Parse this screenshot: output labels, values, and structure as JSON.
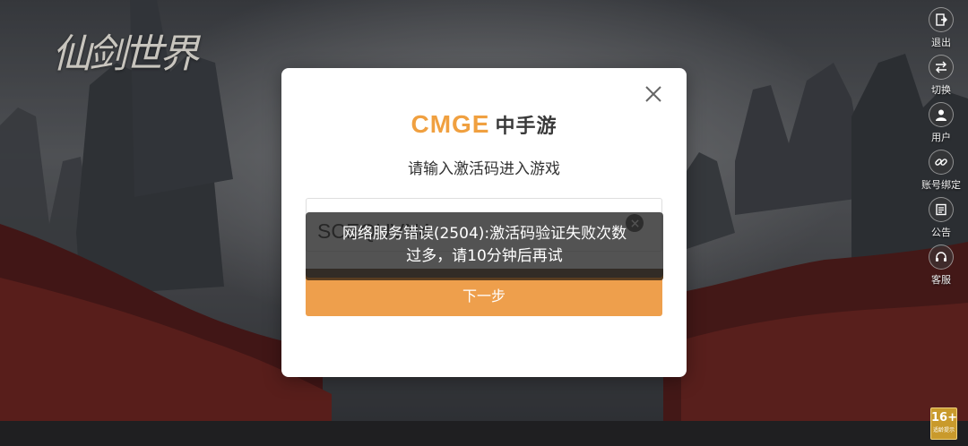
{
  "game": {
    "logo_text": "仙剑世界"
  },
  "sidebar": {
    "items": [
      {
        "label": "退出",
        "icon": "exit-icon"
      },
      {
        "label": "切换",
        "icon": "switch-icon"
      },
      {
        "label": "用户",
        "icon": "user-icon"
      },
      {
        "label": "账号绑定",
        "icon": "link-icon"
      },
      {
        "label": "公告",
        "icon": "notice-icon"
      },
      {
        "label": "客服",
        "icon": "headset-icon"
      }
    ]
  },
  "modal": {
    "brand_latin": "CMGE",
    "brand_cn": "中手游",
    "prompt": "请输入激活码进入游戏",
    "code_value": "SCEQUVN4",
    "next_label": "下一步"
  },
  "toast": {
    "line1": "网络服务错误(2504):激活码验证失败次数",
    "line2": "过多，请10分钟后再试"
  },
  "colors": {
    "accent": "#ee9f4c",
    "brand_orange": "#f0a040",
    "toast_bg": "#282828"
  },
  "age_rating": {
    "value": "16+",
    "caption": "适龄提示"
  }
}
